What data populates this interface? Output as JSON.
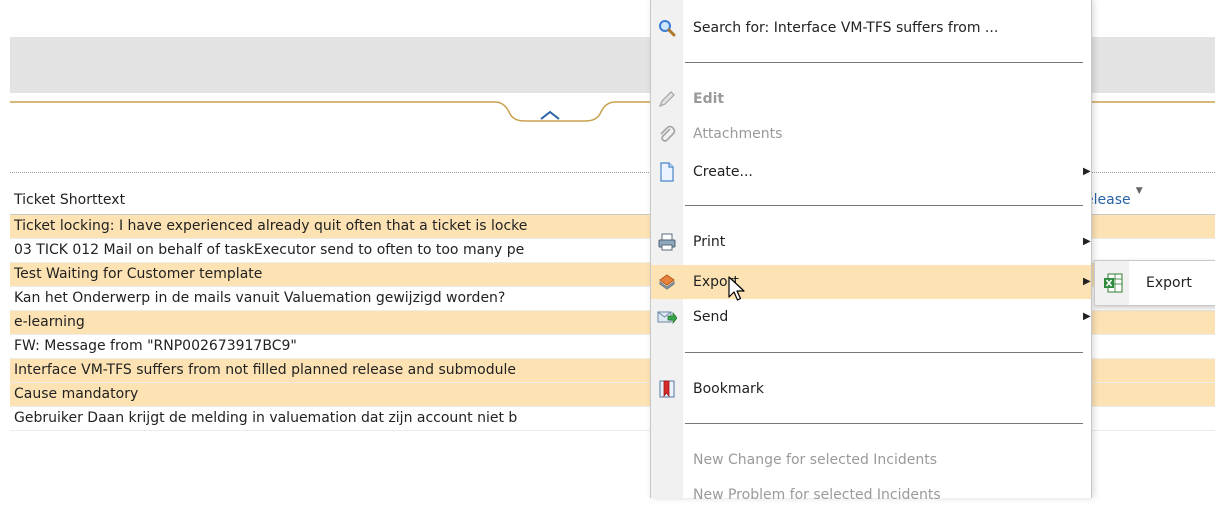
{
  "grid": {
    "header_label": "Ticket Shorttext",
    "release_header": "elease",
    "rows": [
      "Ticket locking: I have experienced already quit often that a ticket is locke",
      "03 TICK 012 Mail on behalf of taskExecutor send to often to too many pe",
      "Test Waiting for Customer template",
      "Kan het Onderwerp in de mails vanuit Valuemation gewijzigd worden?",
      "e-learning",
      "FW: Message from \"RNP002673917BC9\"",
      "Interface VM-TFS suffers from not filled planned release and submodule",
      "Cause mandatory",
      "Gebruiker Daan krijgt de melding in valuemation dat zijn account niet b"
    ]
  },
  "menu": {
    "search": "Search for: Interface VM-TFS suffers from ...",
    "edit": "Edit",
    "attachments": "Attachments",
    "create": "Create...",
    "print": "Print",
    "export": "Export",
    "send": "Send",
    "bookmark": "Bookmark",
    "new_change": "New Change for selected Incidents",
    "new_problem": "New Problem for selected Incidents"
  },
  "submenu": {
    "export": "Export"
  },
  "colors": {
    "row_highlight": "#fde3b4",
    "accent_blue": "#2a62a6"
  }
}
